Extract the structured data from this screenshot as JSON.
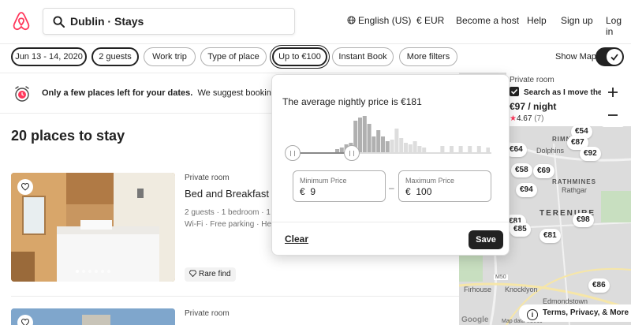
{
  "header": {
    "search_text": "Dublin · Stays",
    "nav": {
      "language": "English (US)",
      "currency": "€ EUR",
      "host": "Become a host",
      "help": "Help",
      "signup": "Sign up",
      "login": "Log in"
    }
  },
  "filters": {
    "dates": "Jun 13 - 14, 2020",
    "guests": "2 guests",
    "work_trip": "Work trip",
    "type_of_place": "Type of place",
    "price": "Up to €100",
    "instant_book": "Instant Book",
    "more_filters": "More filters",
    "show_map_label": "Show Map",
    "show_map_on": true
  },
  "notice": {
    "bold": "Only a few places left for your dates.",
    "rest": "We suggest booking soon."
  },
  "results_title": "20 places to stay",
  "listings": [
    {
      "type": "Private room",
      "title": "Bed and Breakfast I",
      "meta": "2 guests · 1 bedroom · 1 b",
      "amenities": "Wi-Fi · Free parking · Hea",
      "badge": "Rare find",
      "photo_count": 6,
      "photo_index": 0
    },
    {
      "type": "Private room"
    }
  ],
  "price_popup": {
    "average_text": "The average nightly price is €181",
    "min_label": "Minimum Price",
    "min_currency": "€",
    "min_value": "9",
    "max_label": "Maximum Price",
    "max_currency": "€",
    "max_value": "100",
    "separator": "–",
    "clear_label": "Clear",
    "save_label": "Save"
  },
  "map": {
    "card_type": "Private room",
    "card_price": "€97 / night",
    "card_rating": "4.67",
    "card_reviews": "(7)",
    "search_as_move": "Search as I move the map",
    "search_as_move_checked": true,
    "terms": "Terms, Privacy, & More",
    "areas": [
      "RIMNAGH",
      "TERENURE",
      "RATHMINES"
    ],
    "places": [
      "Dolphins",
      "Rathgar",
      "Firhouse",
      "Knocklyon",
      "Edmondstown"
    ],
    "road_label": "M50",
    "pins": [
      "€54",
      "€87",
      "€64",
      "€92",
      "€58",
      "€69",
      "€94",
      "€81",
      "€98",
      "€85",
      "€81",
      "€86"
    ],
    "copyright": "Map data ©2019",
    "google": "Google"
  },
  "colors": {
    "brand": "#FF385C",
    "dark": "#222222",
    "map_bg": "#DCDCDC",
    "histogram_selected": "#B0B0B0",
    "histogram_unselected": "#DDDDDD"
  }
}
